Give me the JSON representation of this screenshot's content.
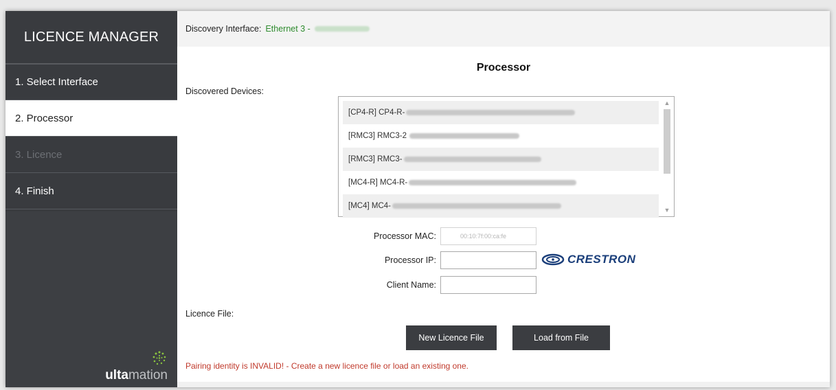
{
  "sidebar": {
    "title": "LICENCE MANAGER",
    "items": [
      {
        "label": "1. Select Interface",
        "state": "normal"
      },
      {
        "label": "2. Processor",
        "state": "active"
      },
      {
        "label": "3. Licence",
        "state": "disabled"
      },
      {
        "label": "4. Finish",
        "state": "normal"
      }
    ],
    "logo": {
      "bold": "ulta",
      "light": "mation"
    }
  },
  "header": {
    "discovery_label": "Discovery Interface:",
    "discovery_value": "Ethernet 3 -"
  },
  "main": {
    "title": "Processor",
    "discovered_label": "Discovered Devices:",
    "devices": [
      "[CP4-R] CP4-R-",
      "[RMC3] RMC3-2",
      "[RMC3] RMC3-",
      "[MC4-R] MC4-R-",
      "[MC4] MC4-"
    ],
    "form": {
      "mac_label": "Processor MAC:",
      "mac_value": "00:10:7f:00:ca:fe",
      "ip_label": "Processor IP:",
      "ip_value": "",
      "client_label": "Client Name:",
      "client_value": ""
    },
    "brand_logo": "CRESTRON",
    "licence_file_label": "Licence File:",
    "buttons": {
      "new": "New Licence File",
      "load": "Load from File"
    },
    "error": "Pairing identity is INVALID! - Create a new licence file or load an existing one."
  },
  "colors": {
    "sidebar_bg": "#393b3f",
    "accent_green": "#2e8b2e",
    "error_red": "#c0392b",
    "button_bg": "#3b3d41",
    "crestron_blue": "#1a3e7a"
  }
}
